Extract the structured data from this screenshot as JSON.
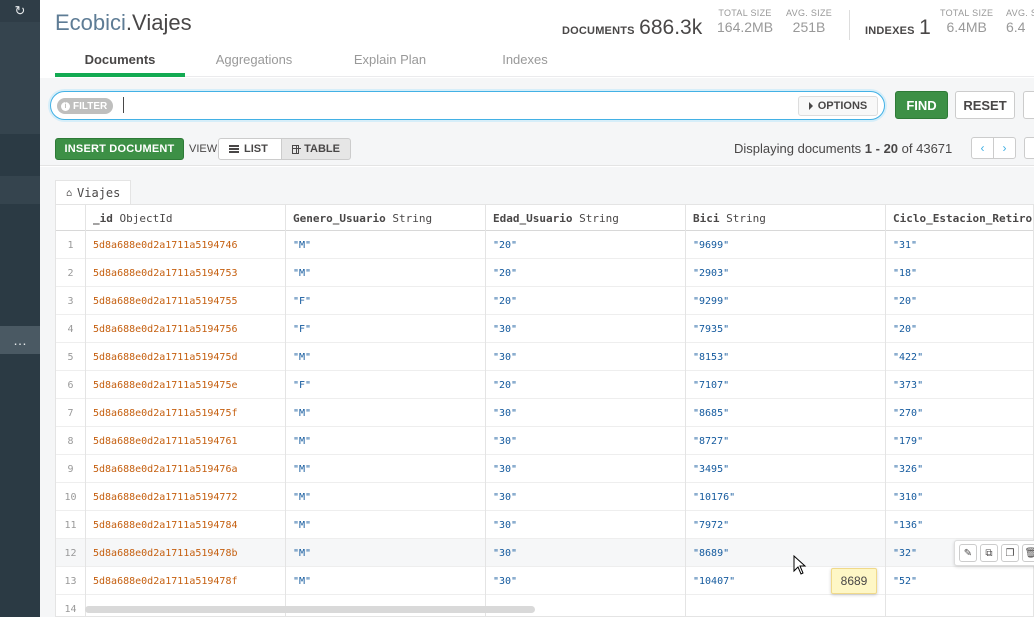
{
  "sidebar": {
    "refresh_glyph": "↻",
    "more_label": "…"
  },
  "header": {
    "db_name": "Ecobici",
    "separator": ".",
    "coll_name": "Viajes",
    "documents_label": "DOCUMENTS",
    "documents_value": "686.3k",
    "doc_total_size_label": "TOTAL SIZE",
    "doc_total_size_value": "164.2MB",
    "doc_avg_size_label": "AVG. SIZE",
    "doc_avg_size_value": "251B",
    "indexes_label": "INDEXES",
    "indexes_value": "1",
    "idx_total_size_label": "TOTAL SIZE",
    "idx_total_size_value": "6.4MB",
    "idx_avg_size_label": "AVG. S",
    "idx_avg_size_value": "6.4"
  },
  "tabs": [
    {
      "label": "Documents",
      "active": true
    },
    {
      "label": "Aggregations",
      "active": false
    },
    {
      "label": "Explain Plan",
      "active": false
    },
    {
      "label": "Indexes",
      "active": false
    }
  ],
  "query": {
    "filter_label": "FILTER",
    "filter_value": "",
    "options_label": "OPTIONS",
    "find_label": "FIND",
    "reset_label": "RESET"
  },
  "toolbar": {
    "insert_label": "INSERT DOCUMENT",
    "view_label": "VIEW",
    "list_label": "LIST",
    "table_label": "TABLE",
    "display_prefix": "Displaying documents ",
    "display_range": "1 - 20",
    "display_of": " of 43671"
  },
  "collection_tab": "Viajes",
  "columns": [
    {
      "name": "_id",
      "type": "ObjectId"
    },
    {
      "name": "Genero_Usuario",
      "type": "String"
    },
    {
      "name": "Edad_Usuario",
      "type": "String"
    },
    {
      "name": "Bici",
      "type": "String"
    },
    {
      "name": "Ciclo_Estacion_Retiro",
      "type": ""
    }
  ],
  "rows": [
    {
      "n": "1",
      "id": "5d8a688e0d2a1711a5194746",
      "genero": "\"M\"",
      "edad": "\"20\"",
      "bici": "\"9699\"",
      "ciclo": "\"31\""
    },
    {
      "n": "2",
      "id": "5d8a688e0d2a1711a5194753",
      "genero": "\"M\"",
      "edad": "\"20\"",
      "bici": "\"2903\"",
      "ciclo": "\"18\""
    },
    {
      "n": "3",
      "id": "5d8a688e0d2a1711a5194755",
      "genero": "\"F\"",
      "edad": "\"20\"",
      "bici": "\"9299\"",
      "ciclo": "\"20\""
    },
    {
      "n": "4",
      "id": "5d8a688e0d2a1711a5194756",
      "genero": "\"F\"",
      "edad": "\"30\"",
      "bici": "\"7935\"",
      "ciclo": "\"20\""
    },
    {
      "n": "5",
      "id": "5d8a688e0d2a1711a519475d",
      "genero": "\"M\"",
      "edad": "\"30\"",
      "bici": "\"8153\"",
      "ciclo": "\"422\""
    },
    {
      "n": "6",
      "id": "5d8a688e0d2a1711a519475e",
      "genero": "\"F\"",
      "edad": "\"20\"",
      "bici": "\"7107\"",
      "ciclo": "\"373\""
    },
    {
      "n": "7",
      "id": "5d8a688e0d2a1711a519475f",
      "genero": "\"M\"",
      "edad": "\"30\"",
      "bici": "\"8685\"",
      "ciclo": "\"270\""
    },
    {
      "n": "8",
      "id": "5d8a688e0d2a1711a5194761",
      "genero": "\"M\"",
      "edad": "\"30\"",
      "bici": "\"8727\"",
      "ciclo": "\"179\""
    },
    {
      "n": "9",
      "id": "5d8a688e0d2a1711a519476a",
      "genero": "\"M\"",
      "edad": "\"30\"",
      "bici": "\"3495\"",
      "ciclo": "\"326\""
    },
    {
      "n": "10",
      "id": "5d8a688e0d2a1711a5194772",
      "genero": "\"M\"",
      "edad": "\"30\"",
      "bici": "\"10176\"",
      "ciclo": "\"310\""
    },
    {
      "n": "11",
      "id": "5d8a688e0d2a1711a5194784",
      "genero": "\"M\"",
      "edad": "\"30\"",
      "bici": "\"7972\"",
      "ciclo": "\"136\""
    },
    {
      "n": "12",
      "id": "5d8a688e0d2a1711a519478b",
      "genero": "\"M\"",
      "edad": "\"30\"",
      "bici": "\"8689\"",
      "ciclo": "\"32\""
    },
    {
      "n": "13",
      "id": "5d8a688e0d2a1711a519478f",
      "genero": "\"M\"",
      "edad": "\"30\"",
      "bici": "\"10407\"",
      "ciclo": "\"52\""
    },
    {
      "n": "14",
      "id": "",
      "genero": "",
      "edad": "",
      "bici": "",
      "ciclo": ""
    }
  ],
  "row_actions": {
    "edit_icon": "✎",
    "clone_icon": "⧉",
    "copy_icon": "❐",
    "delete_icon": "🗑"
  },
  "tooltip": "8689",
  "colors": {
    "accent_green": "#13aa52",
    "button_green": "#3d9046",
    "objectid_orange": "#c55f0f",
    "string_blue": "#145a9e",
    "sidebar": "#2b3a44"
  }
}
